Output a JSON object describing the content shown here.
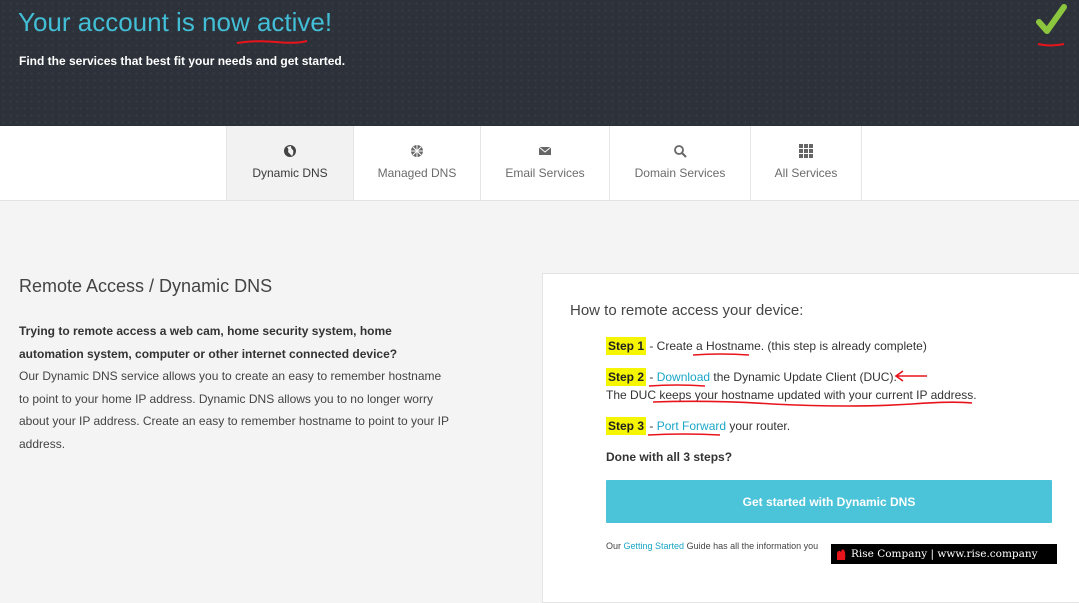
{
  "hero": {
    "title": "Your account is now active!",
    "subtitle": "Find the services that best fit your needs and get started."
  },
  "tabs": [
    {
      "label": "Dynamic DNS",
      "icon": "globe-icon",
      "active": true
    },
    {
      "label": "Managed DNS",
      "icon": "globe-grid-icon",
      "active": false
    },
    {
      "label": "Email Services",
      "icon": "envelope-icon",
      "active": false
    },
    {
      "label": "Domain Services",
      "icon": "magnifier-icon",
      "active": false
    },
    {
      "label": "All Services",
      "icon": "grid-icon",
      "active": false
    }
  ],
  "left": {
    "title": "Remote Access / Dynamic DNS",
    "question": "Trying to remote access a web cam, home security system, home automation system, computer or other internet connected device?",
    "body": "Our Dynamic DNS service allows you to create an easy to remember hostname to point to your home IP address. Dynamic DNS allows you to no longer worry about your IP address. Create an easy to remember hostname to point to your IP address."
  },
  "card": {
    "title": "How to remote access your device:",
    "step1": {
      "label": "Step 1",
      "pre": " - Create a ",
      "link": "Hostname",
      "post": ". (this step is already complete)"
    },
    "step2": {
      "label": "Step 2",
      "pre": " - ",
      "link": "Download",
      "post": " the Dynamic Update Client (DUC).",
      "line2": "The DUC keeps your hostname updated with your current IP address."
    },
    "step3": {
      "label": "Step 3",
      "pre": " - ",
      "link": "Port Forward",
      "post": " your router."
    },
    "done": "Done with all 3 steps?",
    "cta": "Get started with Dynamic DNS",
    "footer_pre": "Our ",
    "footer_link": "Getting Started",
    "footer_post": " Guide has all the information you"
  },
  "watermark": {
    "text": "Rise Company | www.rise.company"
  },
  "colors": {
    "accent": "#42bfd6",
    "hero_bg": "#2c313a",
    "cta": "#4bc3d8",
    "highlight": "#f5f500",
    "annotation": "#e8141c"
  }
}
